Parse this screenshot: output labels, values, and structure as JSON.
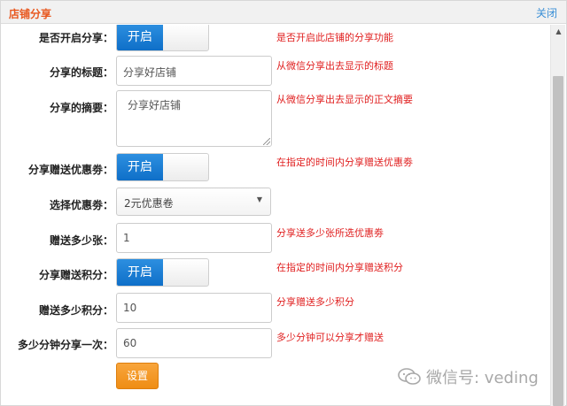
{
  "dialog": {
    "title": "店铺分享",
    "close_label": "关闭"
  },
  "form": {
    "enable_share": {
      "label": "是否开启分享：",
      "toggle_on": "开启",
      "hint": "是否开启此店铺的分享功能"
    },
    "share_title": {
      "label": "分享的标题：",
      "value": "分享好店铺",
      "hint": "从微信分享出去显示的标题"
    },
    "share_summary": {
      "label": "分享的摘要：",
      "value": "分享好店铺",
      "hint": "从微信分享出去显示的正文摘要"
    },
    "share_coupon": {
      "label": "分享赠送优惠劵：",
      "toggle_on": "开启",
      "hint": "在指定的时间内分享赠送优惠劵"
    },
    "select_coupon": {
      "label": "选择优惠劵：",
      "value": "2元优惠卷"
    },
    "coupon_count": {
      "label": "赠送多少张：",
      "value": "1",
      "hint": "分享送多少张所选优惠劵"
    },
    "share_points": {
      "label": "分享赠送积分：",
      "toggle_on": "开启",
      "hint": "在指定的时间内分享赠送积分"
    },
    "points_amount": {
      "label": "赠送多少积分：",
      "value": "10",
      "hint": "分享赠送多少积分"
    },
    "interval": {
      "label": "多少分钟分享一次：",
      "value": "60",
      "hint": "多少分钟可以分享才赠送"
    },
    "submit_label": "设置"
  },
  "watermark": {
    "text": "微信号: veding"
  },
  "colors": {
    "accent_title": "#e8571e",
    "hint_red": "#e02020",
    "toggle_blue": "#1a7fd8",
    "button_orange": "#f39a22",
    "link_blue": "#3a8fd6"
  }
}
